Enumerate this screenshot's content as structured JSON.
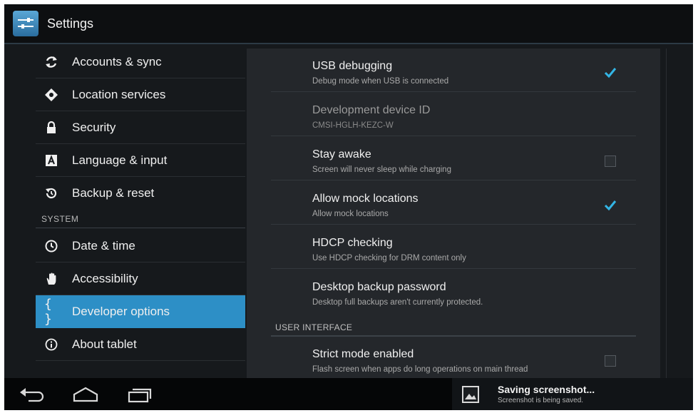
{
  "action_bar": {
    "title": "Settings",
    "icon": "settings-sliders-icon"
  },
  "left_pane": {
    "items_top": [
      {
        "label": "Accounts & sync",
        "icon": "sync-icon"
      },
      {
        "label": "Location services",
        "icon": "location-icon"
      },
      {
        "label": "Security",
        "icon": "lock-icon"
      },
      {
        "label": "Language & input",
        "icon": "language-icon"
      },
      {
        "label": "Backup & reset",
        "icon": "backup-icon"
      }
    ],
    "section_system": "SYSTEM",
    "items_system": [
      {
        "label": "Date & time",
        "icon": "clock-icon"
      },
      {
        "label": "Accessibility",
        "icon": "hand-icon"
      },
      {
        "label": "Developer options",
        "icon": "braces-icon",
        "selected": true
      },
      {
        "label": "About tablet",
        "icon": "info-icon"
      }
    ]
  },
  "developer_options": {
    "prefs": [
      {
        "title": "USB debugging",
        "summary": "Debug mode when USB is connected",
        "checkbox": true,
        "checked": true
      },
      {
        "title": "Development device ID",
        "summary": "CMSI-HGLH-KEZC-W",
        "checkbox": false,
        "disabled": true
      },
      {
        "title": "Stay awake",
        "summary": "Screen will never sleep while charging",
        "checkbox": true,
        "checked": false
      },
      {
        "title": "Allow mock locations",
        "summary": "Allow mock locations",
        "checkbox": true,
        "checked": true
      },
      {
        "title": "HDCP checking",
        "summary": "Use HDCP checking for DRM content only",
        "checkbox": false
      },
      {
        "title": "Desktop backup password",
        "summary": "Desktop full backups aren't currently protected.",
        "checkbox": false
      }
    ],
    "category_ui": "USER INTERFACE",
    "prefs_ui": [
      {
        "title": "Strict mode enabled",
        "summary": "Flash screen when apps do long operations on main thread",
        "checkbox": true,
        "checked": false
      }
    ]
  },
  "nav_bar": {
    "back": "back-icon",
    "home": "home-icon",
    "recents": "recents-icon"
  },
  "notification": {
    "title": "Saving screenshot...",
    "summary": "Screenshot is being saved.",
    "icon": "image-icon"
  },
  "colors": {
    "accent": "#2d8fc6",
    "checkmark": "#33b5e5",
    "background": "#16191c",
    "panel": "#24272b"
  }
}
